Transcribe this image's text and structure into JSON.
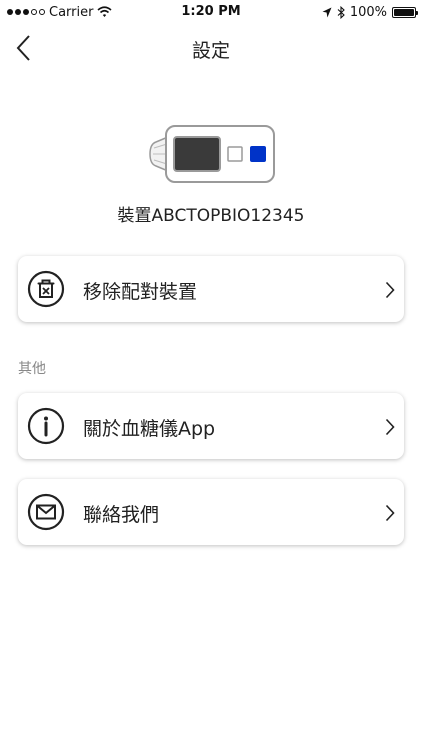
{
  "status_bar": {
    "carrier": "Carrier",
    "time": "1:20 PM",
    "battery": "100%"
  },
  "nav": {
    "title": "設定"
  },
  "device": {
    "label": "裝置ABCTOPBIO12345"
  },
  "actions": {
    "remove_paired_device": "移除配對裝置"
  },
  "others": {
    "header": "其他",
    "items": [
      {
        "label": "關於血糖儀App",
        "icon": "info-icon"
      },
      {
        "label": "聯絡我們",
        "icon": "mail-icon"
      }
    ]
  },
  "colors": {
    "accent_blue": "#0033c8",
    "device_dark": "#3a3a3a",
    "section_header": "#888888"
  }
}
